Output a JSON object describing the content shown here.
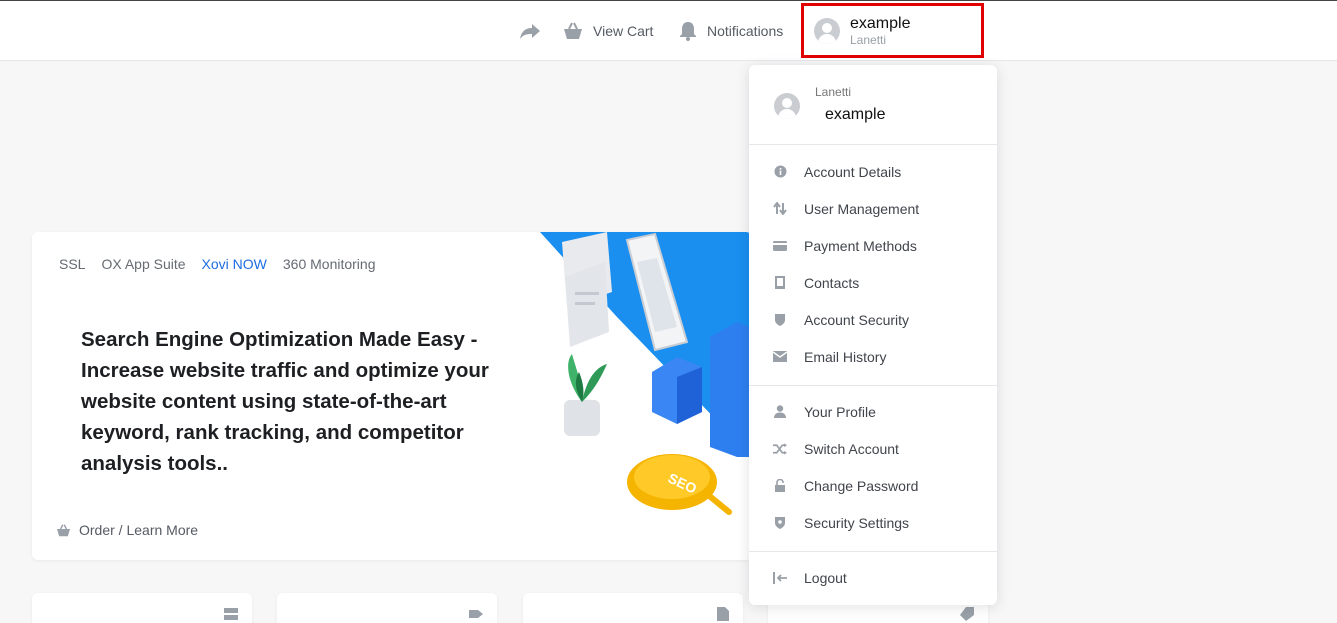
{
  "topbar": {
    "view_cart": "View Cart",
    "notifications": "Notifications",
    "user_name": "example",
    "user_company": "Lanetti"
  },
  "card": {
    "tabs": [
      "SSL",
      "OX App Suite",
      "Xovi NOW",
      "360 Monitoring"
    ],
    "active_tab": "Xovi NOW",
    "promo_text": "Search Engine Optimization Made Easy - Increase website traffic and optimize your website content using state-of-the-art keyword, rank tracking, and competitor analysis tools..",
    "footer_link": "Order / Learn More",
    "badge_text": "SEO"
  },
  "dropdown": {
    "company": "Lanetti",
    "name": "example",
    "account_items": [
      {
        "label": "Account Details",
        "icon": "info-icon"
      },
      {
        "label": "User Management",
        "icon": "arrows-updown-icon"
      },
      {
        "label": "Payment Methods",
        "icon": "wallet-icon"
      },
      {
        "label": "Contacts",
        "icon": "contact-book-icon"
      },
      {
        "label": "Account Security",
        "icon": "shield-icon"
      },
      {
        "label": "Email History",
        "icon": "envelope-icon"
      }
    ],
    "profile_items": [
      {
        "label": "Your Profile",
        "icon": "user-icon"
      },
      {
        "label": "Switch Account",
        "icon": "shuffle-icon"
      },
      {
        "label": "Change Password",
        "icon": "lock-icon"
      },
      {
        "label": "Security Settings",
        "icon": "shield-check-icon"
      }
    ],
    "logout": "Logout"
  },
  "colors": {
    "accent": "#1e6de0",
    "highlight_border": "#e00000",
    "icon_gray": "#9aa0a8"
  }
}
